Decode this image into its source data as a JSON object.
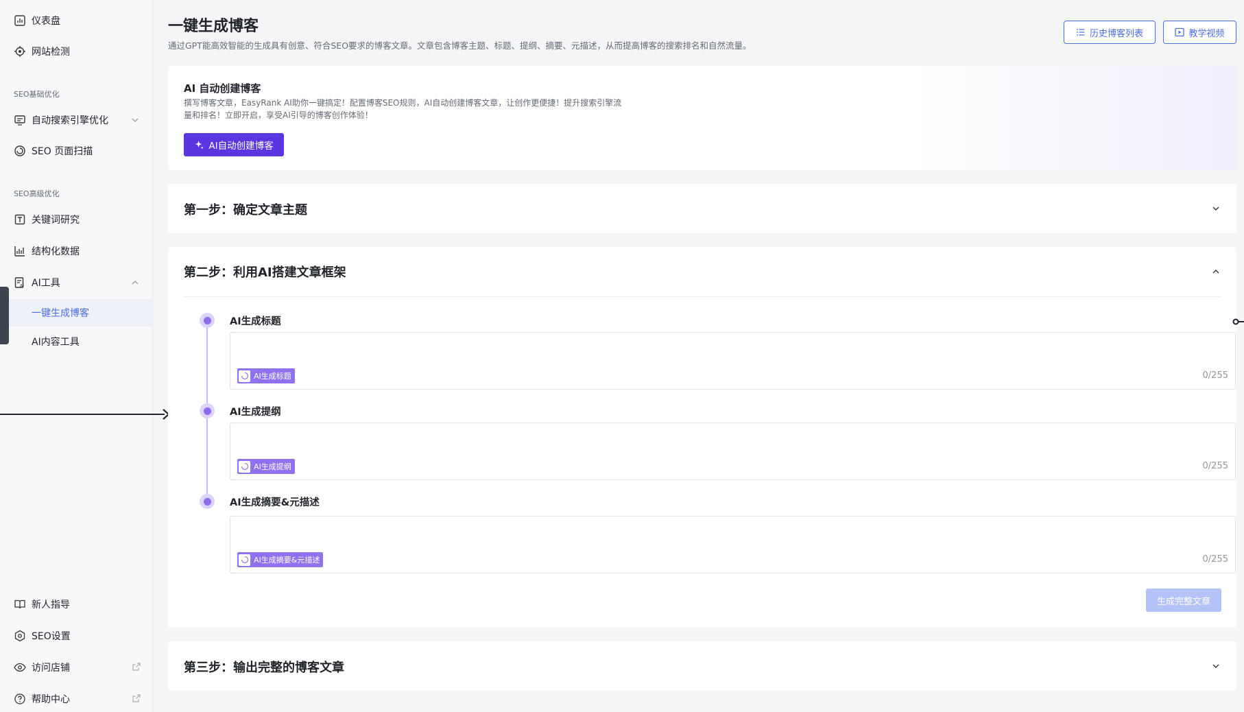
{
  "sidebar": {
    "items_top": [
      {
        "label": "仪表盘",
        "icon": "dashboard-icon"
      },
      {
        "label": "网站检测",
        "icon": "target-icon"
      }
    ],
    "section_basic": "SEO基础优化",
    "items_basic": [
      {
        "label": "自动搜索引擎优化",
        "icon": "monitor-icon"
      },
      {
        "label": "SEO 页面扫描",
        "icon": "scan-icon"
      }
    ],
    "section_advanced": "SEO高级优化",
    "items_advanced": [
      {
        "label": "关键词研究",
        "icon": "keyword-icon"
      },
      {
        "label": "结构化数据",
        "icon": "chart-icon"
      },
      {
        "label": "AI工具",
        "icon": "ai-tool-icon"
      }
    ],
    "ai_sub": [
      {
        "label": "一键生成博客",
        "active": true
      },
      {
        "label": "AI内容工具",
        "active": false
      }
    ],
    "items_bottom": [
      {
        "label": "新人指导",
        "icon": "book-icon"
      },
      {
        "label": "SEO设置",
        "icon": "settings-icon"
      },
      {
        "label": "访问店铺",
        "icon": "eye-icon"
      },
      {
        "label": "帮助中心",
        "icon": "help-icon"
      }
    ]
  },
  "header": {
    "title": "一键生成博客",
    "description": "通过GPT能高效智能的生成具有创意、符合SEO要求的博客文章。文章包含博客主题、标题、提纲、摘要、元描述，从而提高博客的搜索排名和自然流量。",
    "history_button": "历史博客列表",
    "tutorial_button": "教学视频"
  },
  "hero": {
    "title": "AI 自动创建博客",
    "text": "撰写博客文章，EasyRank AI助你一键搞定！配置博客SEO规则，AI自动创建博客文章，让创作更便捷！提升搜索引擎流量和排名！立即开启，享受AI引导的博客创作体验！",
    "button": "AI自动创建博客"
  },
  "steps": {
    "step1": "第一步：确定文章主题",
    "step2": "第二步：利用AI搭建文章框架",
    "step3": "第三步：输出完整的博客文章"
  },
  "fields": [
    {
      "label": "AI生成标题",
      "chip": "AI生成标题",
      "counter": "0/255"
    },
    {
      "label": "AI生成提纲",
      "chip": "AI生成提纲",
      "counter": "0/255"
    },
    {
      "label": "AI生成摘要&元描述",
      "chip": "AI生成摘要&元描述",
      "counter": "0/255"
    }
  ],
  "generate_button": "生成完整文章",
  "colors": {
    "accent": "#4d6ce0",
    "primary_purple": "#5b35e0",
    "chip_purple": "#9071ef",
    "disabled_blue": "#b3c3f7"
  }
}
